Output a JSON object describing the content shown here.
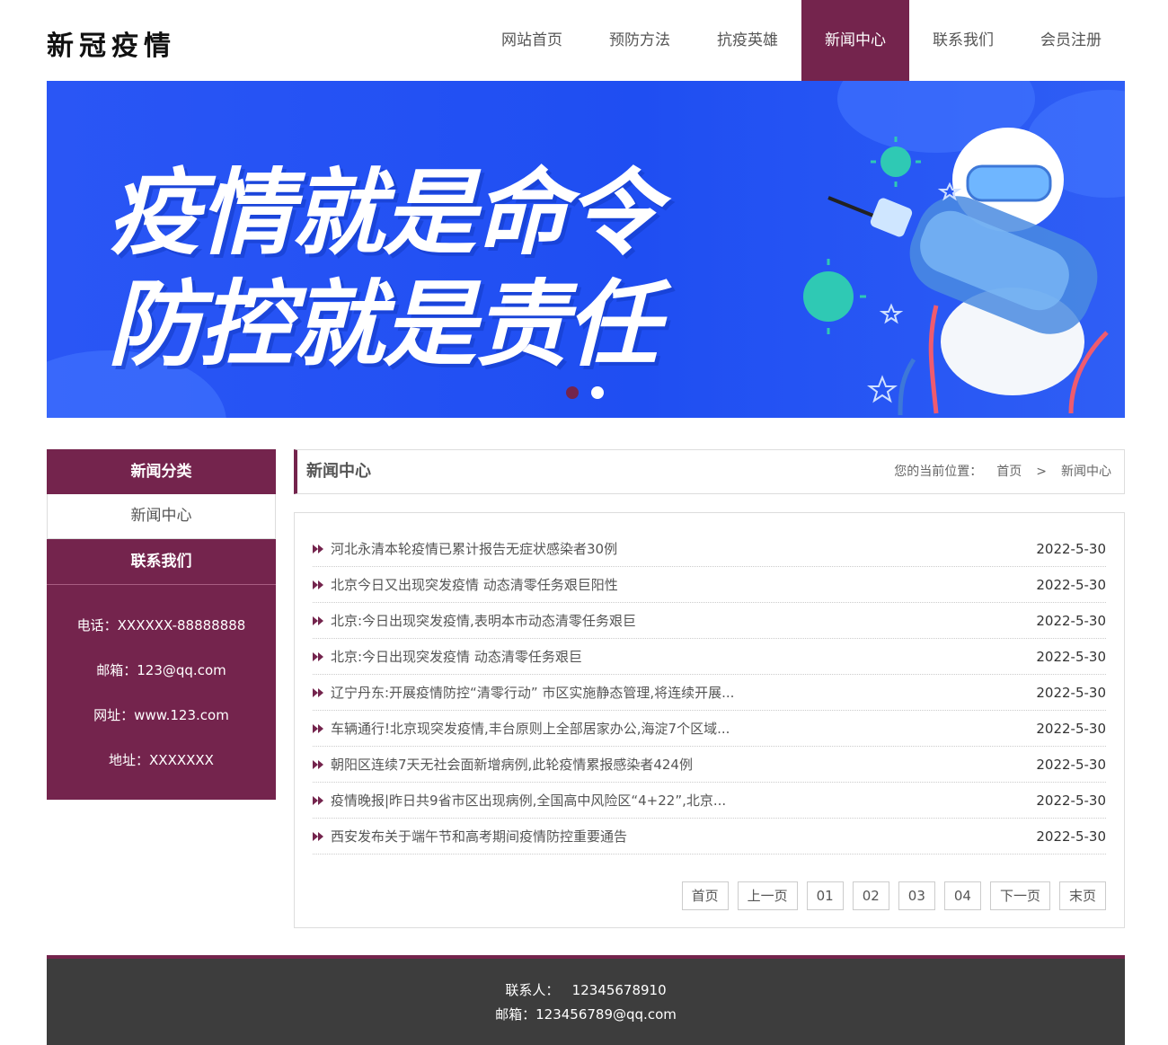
{
  "header": {
    "logo": "新冠疫情",
    "nav": [
      {
        "label": "网站首页",
        "active": false
      },
      {
        "label": "预防方法",
        "active": false
      },
      {
        "label": "抗疫英雄",
        "active": false
      },
      {
        "label": "新闻中心",
        "active": true
      },
      {
        "label": "联系我们",
        "active": false
      },
      {
        "label": "会员注册",
        "active": false
      }
    ]
  },
  "banner": {
    "line1": "疫情就是命令",
    "line2": "防控就是责任"
  },
  "sidebar": {
    "category_title": "新闻分类",
    "category_item": "新闻中心",
    "contact_title": "联系我们",
    "contact": {
      "phone": "电话：XXXXXX-88888888",
      "email": "邮箱：123@qq.com",
      "site": "网址：www.123.com",
      "address": "地址：XXXXXXX"
    }
  },
  "main": {
    "title": "新闻中心",
    "breadcrumb": {
      "prefix": "您的当前位置：",
      "home": "首页",
      "sep": ">",
      "current": "新闻中心"
    },
    "news": [
      {
        "title": "河北永清本轮疫情已累计报告无症状感染者30例",
        "date": "2022-5-30"
      },
      {
        "title": "北京今日又出现突发疫情 动态清零任务艰巨阳性",
        "date": "2022-5-30"
      },
      {
        "title": "北京:今日出现突发疫情,表明本市动态清零任务艰巨",
        "date": "2022-5-30"
      },
      {
        "title": "北京:今日出现突发疫情 动态清零任务艰巨",
        "date": "2022-5-30"
      },
      {
        "title": "辽宁丹东:开展疫情防控“清零行动” 市区实施静态管理,将连续开展...",
        "date": "2022-5-30"
      },
      {
        "title": "车辆通行!北京现突发疫情,丰台原则上全部居家办公,海淀7个区域...",
        "date": "2022-5-30"
      },
      {
        "title": "朝阳区连续7天无社会面新增病例,此轮疫情累报感染者424例",
        "date": "2022-5-30"
      },
      {
        "title": "疫情晚报|昨日共9省市区出现病例,全国高中风险区“4+22”,北京...",
        "date": "2022-5-30"
      },
      {
        "title": "西安发布关于端午节和高考期间疫情防控重要通告",
        "date": "2022-5-30"
      }
    ],
    "pager": [
      "首页",
      "上一页",
      "01",
      "02",
      "03",
      "04",
      "下一页",
      "末页"
    ]
  },
  "footer": {
    "contact": "联系人：   12345678910",
    "email": "邮箱：123456789@qq.com"
  },
  "colors": {
    "accent": "#74244d",
    "banner_blue": "#1f4ef2",
    "footer_bg": "#3d3d3d"
  }
}
